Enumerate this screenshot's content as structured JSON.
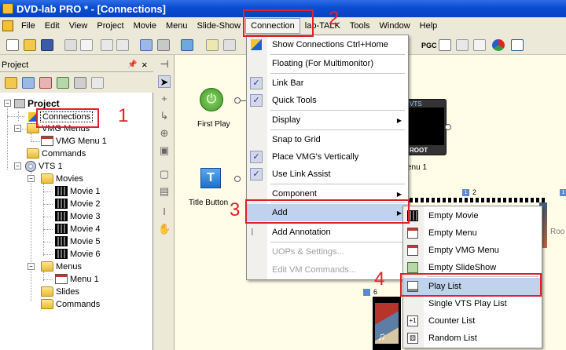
{
  "window": {
    "title": "DVD-lab PRO * - [Connections]"
  },
  "menubar": {
    "items": [
      "File",
      "Edit",
      "View",
      "Project",
      "Movie",
      "Menu",
      "Slide-Show",
      "Connection",
      "lab-TALK",
      "Tools",
      "Window",
      "Help"
    ]
  },
  "toolbar": {
    "pgc_label": "PGC"
  },
  "project_panel": {
    "title": "Project",
    "tree": {
      "root": "Project",
      "connections": "Connections",
      "vmg_menus": "VMG Menus",
      "vmg_menu_1": "VMG Menu 1",
      "commands_top": "Commands",
      "vts1": "VTS 1",
      "movies": "Movies",
      "movie_items": [
        "Movie 1",
        "Movie 2",
        "Movie 3",
        "Movie 4",
        "Movie 5",
        "Movie 6"
      ],
      "menus": "Menus",
      "menu_1": "Menu 1",
      "slides": "Slides",
      "commands_vts": "Commands"
    }
  },
  "canvas": {
    "first_play": "First Play",
    "title_button": "Title Button",
    "vts_label": "VTS",
    "root_label": "ROOT",
    "menu_1_partial": "enu 1",
    "badge_1": "1",
    "badge_2": "2",
    "badge_3": "1",
    "badge_4": "6",
    "root_right": "Roo"
  },
  "connection_menu": {
    "items": [
      {
        "label": "Show Connections",
        "shortcut": "Ctrl+Home",
        "checked": false,
        "icon": "connections-icon"
      },
      {
        "label": "Floating (For Multimonitor)",
        "checked": false
      },
      {
        "label": "Link Bar",
        "checked": true
      },
      {
        "label": "Quick Tools",
        "checked": true
      },
      {
        "label": "Display",
        "submenu": true
      },
      {
        "label": "Snap to Grid",
        "checked": false
      },
      {
        "label": "Place VMG's Vertically",
        "checked": true
      },
      {
        "label": "Use Link Assist",
        "checked": true
      },
      {
        "label": "Component",
        "submenu": true
      },
      {
        "label": "Add",
        "submenu": true,
        "highlighted": true
      },
      {
        "label": "Add Annotation",
        "icon": "annotation-icon"
      },
      {
        "label": "UOPs & Settings...",
        "disabled": true
      },
      {
        "label": "Edit VM Commands...",
        "disabled": true
      }
    ]
  },
  "add_submenu": {
    "items": [
      "Empty Movie",
      "Empty Menu",
      "Empty VMG Menu",
      "Empty SlideShow",
      "Play List",
      "Single VTS Play List",
      "Counter List",
      "Random List"
    ],
    "highlighted": "Play List"
  },
  "annotations": [
    "1",
    "2",
    "3",
    "4"
  ],
  "colors": {
    "annotation_red": "#E0202A",
    "highlight": "#C1D2EE",
    "title_blue": "#0A4CD0"
  }
}
